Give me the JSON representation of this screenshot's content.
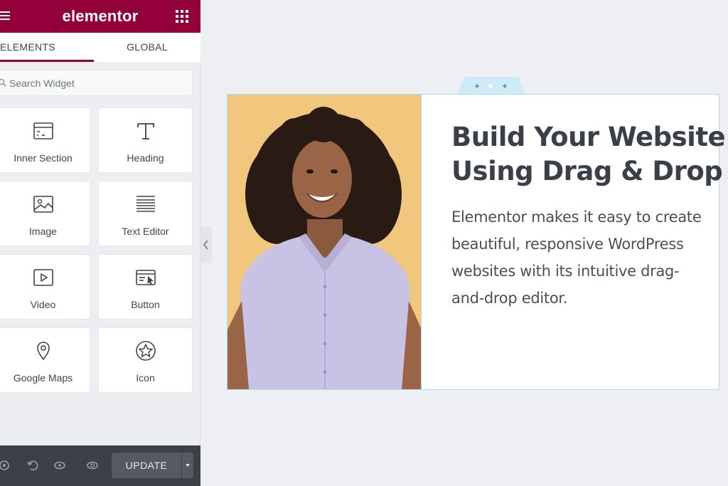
{
  "app": {
    "logo_text": "elementor"
  },
  "tabs": [
    {
      "label": "ELEMENTS",
      "active": true
    },
    {
      "label": "GLOBAL",
      "active": false
    }
  ],
  "search": {
    "placeholder": "Search Widget",
    "value": ""
  },
  "widgets": [
    {
      "label": "Inner Section",
      "icon": "inner-section-icon"
    },
    {
      "label": "Heading",
      "icon": "heading-icon"
    },
    {
      "label": "Image",
      "icon": "image-icon"
    },
    {
      "label": "Text Editor",
      "icon": "text-editor-icon"
    },
    {
      "label": "Video",
      "icon": "video-icon"
    },
    {
      "label": "Button",
      "icon": "button-icon"
    },
    {
      "label": "Google Maps",
      "icon": "map-pin-icon"
    },
    {
      "label": "Icon",
      "icon": "star-icon"
    }
  ],
  "footer": {
    "update_label": "UPDATE"
  },
  "canvas": {
    "headline_lines": [
      "Build Your Website",
      "Using Drag & Drop"
    ],
    "body_lines": [
      "Elementor makes it easy to create",
      "beautiful, responsive WordPress",
      "websites with its intuitive drag-",
      "and-drop editor."
    ]
  },
  "colors": {
    "brand": "#93003a",
    "footer_bg": "#3c4047",
    "section_outline": "#a8dcef",
    "photo_bg": "#f0c77c"
  }
}
